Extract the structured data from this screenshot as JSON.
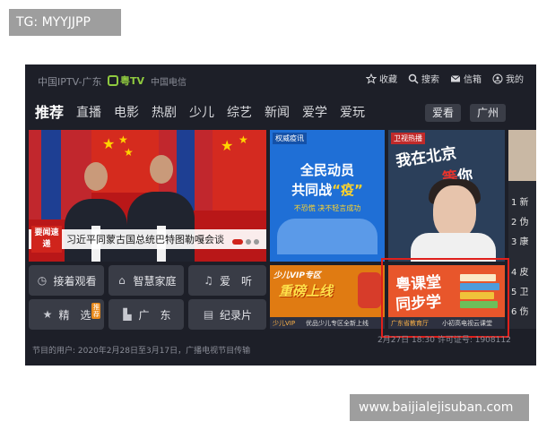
{
  "overlay": {
    "tag_label": "TG: MYYJJPP",
    "watermark": "www.baijialejisuban.com"
  },
  "header": {
    "brand": "中国IPTV-广东",
    "brand_tv": "粤TV",
    "brand_telecom": "中国电信",
    "actions": [
      {
        "label": "收藏",
        "icon": "star-icon"
      },
      {
        "label": "搜索",
        "icon": "search-icon"
      },
      {
        "label": "信箱",
        "icon": "mail-icon"
      },
      {
        "label": "我的",
        "icon": "user-icon"
      }
    ]
  },
  "nav": {
    "items": [
      "推荐",
      "直播",
      "电影",
      "热剧",
      "少儿",
      "综艺",
      "新闻",
      "爱学",
      "爱玩"
    ],
    "active_index": 0,
    "right_buttons": [
      "爱看",
      "广州"
    ]
  },
  "hero": {
    "tag": "要闻速递",
    "caption": "习近平同蒙古国总统巴特图勒嘎会谈"
  },
  "quick_buttons": [
    {
      "label": "接着观看",
      "icon": "clock-icon"
    },
    {
      "label": "智慧家庭",
      "icon": "home-icon"
    },
    {
      "label": "爱　听",
      "icon": "music-icon"
    },
    {
      "label": "精　选",
      "icon": "star-icon",
      "badge": "推荐"
    },
    {
      "label": "广　东",
      "icon": "tv-icon"
    },
    {
      "label": "纪录片",
      "icon": "film-icon"
    }
  ],
  "tiles": {
    "epidemic": {
      "tag": "权威疫讯",
      "line1": "全民动员",
      "line2_a": "共同战",
      "line2_b": "“疫”",
      "line3": "不恐慌 决不轻言成功"
    },
    "beijing": {
      "tag": "卫视热播",
      "title_a": "我在北京",
      "title_b1": "等",
      "title_b2": "你"
    },
    "kids": {
      "header": "少儿VIP专区",
      "big": "重磅上线",
      "foot_a": "少儿VIP",
      "foot_b": "优品少儿专区全新上线"
    },
    "class": {
      "line1": "粤课堂",
      "line2": "同步学",
      "foot_a": "广东省教育厅",
      "foot_b": "小初高电视云课堂"
    },
    "side_list": [
      "1 新",
      "2 伪",
      "3 康",
      "4 皮",
      "5 卫",
      "6 伤"
    ]
  },
  "ticker": {
    "left": "节目的用户: 2020年2月28日至3月17日，广播电视节目传输",
    "right": "2月27日 18:30  许可证号: 1908112"
  },
  "colors": {
    "accent_red": "#e0201c",
    "brand_green": "#8fc93f",
    "tv_bg": "#1d1f28"
  }
}
